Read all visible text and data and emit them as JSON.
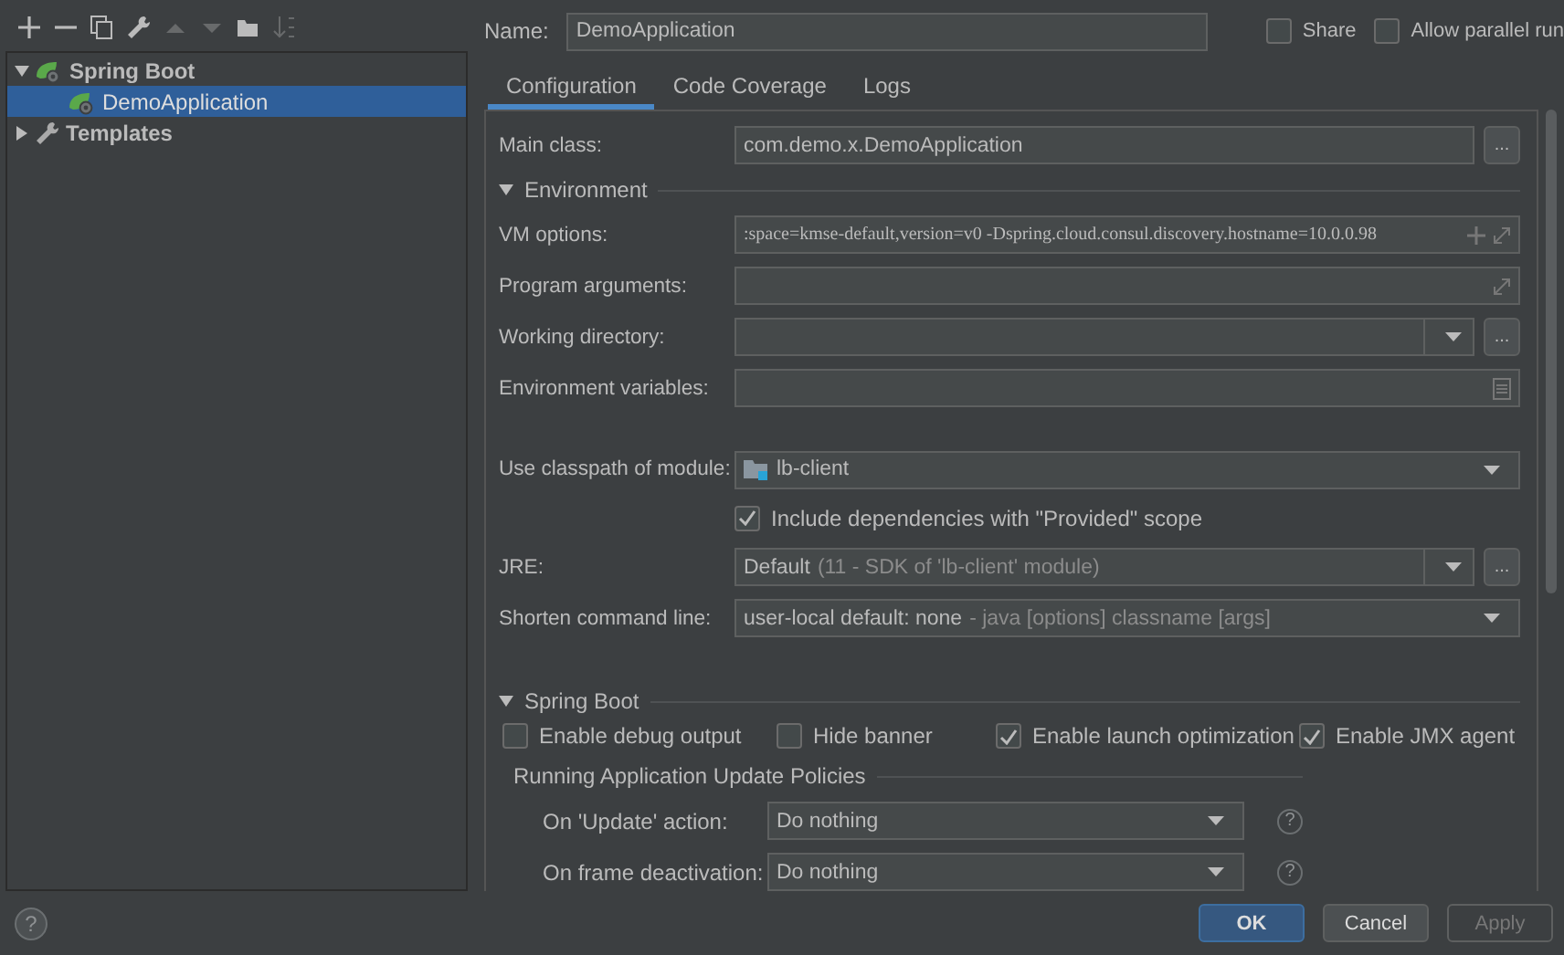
{
  "tree": [
    {
      "label": "Spring Boot",
      "kind": "spring",
      "expanded": true,
      "selected": false,
      "children": [
        {
          "label": "DemoApplication",
          "kind": "spring-app",
          "selected": true
        }
      ]
    },
    {
      "label": "Templates",
      "kind": "wrench",
      "expanded": false,
      "selected": false
    }
  ],
  "name": {
    "label": "Name:",
    "value": "DemoApplication"
  },
  "header_options": [
    {
      "label": "Share",
      "checked": false
    },
    {
      "label": "Allow parallel run",
      "checked": false
    }
  ],
  "tabs": [
    {
      "label": "Configuration",
      "selected": true
    },
    {
      "label": "Code Coverage",
      "selected": false
    },
    {
      "label": "Logs",
      "selected": false
    }
  ],
  "main_class": {
    "label": "Main class:",
    "value": "com.demo.x.DemoApplication",
    "browse": "..."
  },
  "environment": {
    "title": "Environment",
    "expanded": true,
    "fields": [
      {
        "kind": "text-add-expand",
        "label": "VM options:",
        "value": ":space=kmse-default,version=v0 -Dspring.cloud.consul.discovery.hostname=10.0.0.98"
      },
      {
        "kind": "text-expand",
        "label": "Program arguments:"
      },
      {
        "kind": "combo-browse",
        "label": "Working directory:",
        "browse": "..."
      },
      {
        "kind": "text-list",
        "label": "Environment variables:"
      }
    ],
    "module_fields": [
      {
        "kind": "module",
        "label": "Use classpath of module:",
        "value": "lb-client"
      },
      {
        "kind": "checkbox",
        "label": "Include dependencies with \"Provided\" scope",
        "checked": true
      },
      {
        "kind": "combo-browse",
        "label": "JRE:",
        "value": "Default",
        "hint": "(11 - SDK of 'lb-client' module)",
        "browse": "..."
      },
      {
        "kind": "combo",
        "label": "Shorten command line:",
        "value": "user-local default: none",
        "hint": "- java [options] classname [args]"
      }
    ]
  },
  "spring_boot": {
    "title": "Spring Boot",
    "expanded": true,
    "options": [
      {
        "label": "Enable debug output",
        "checked": false
      },
      {
        "label": "Hide banner",
        "checked": false
      },
      {
        "label": "Enable launch optimization",
        "checked": true
      },
      {
        "label": "Enable JMX agent",
        "checked": true
      }
    ],
    "policies": {
      "title": "Running Application Update Policies",
      "rows": [
        {
          "label": "On 'Update' action:",
          "value": "Do nothing",
          "help": "?"
        },
        {
          "label": "On frame deactivation:",
          "value": "Do nothing",
          "help": "?"
        }
      ]
    }
  },
  "help": "?",
  "buttons": [
    {
      "label": "OK",
      "kind": "primary"
    },
    {
      "label": "Cancel",
      "kind": "normal"
    },
    {
      "label": "Apply",
      "kind": "disabled"
    }
  ]
}
